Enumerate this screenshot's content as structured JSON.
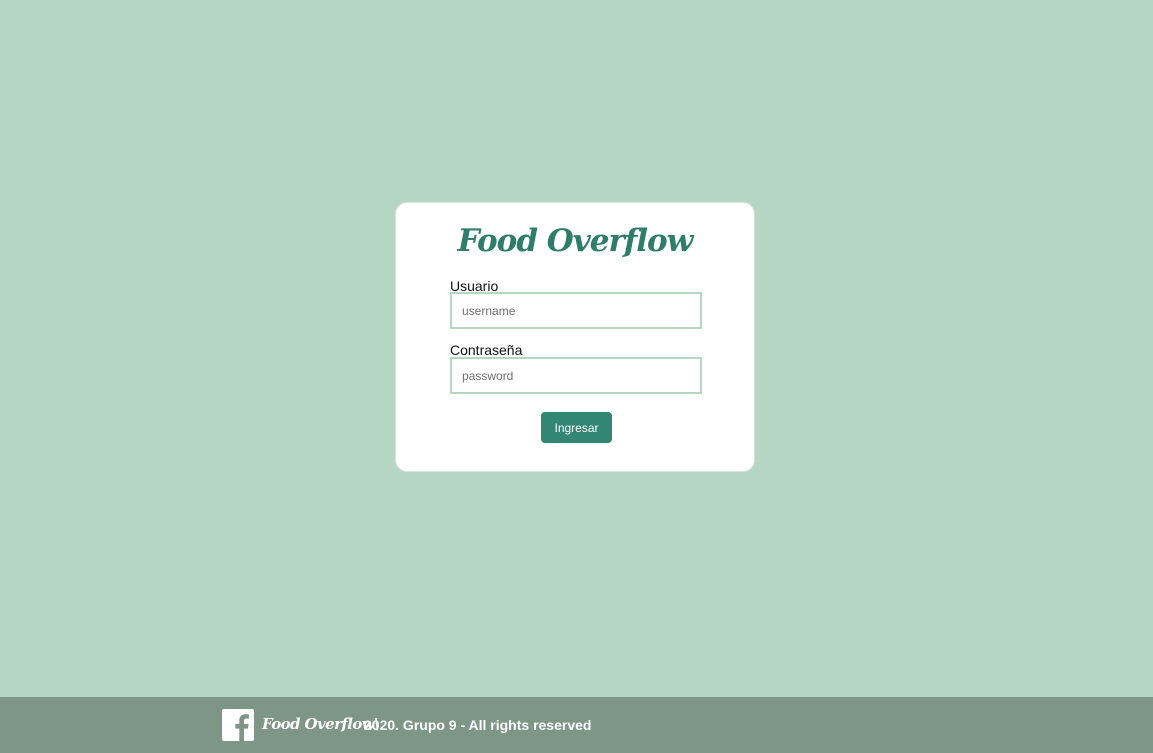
{
  "login_card": {
    "brand": "Food Overflow",
    "username": {
      "label": "Usuario",
      "value": "",
      "placeholder": "username"
    },
    "password": {
      "label": "Contraseña",
      "value": "",
      "placeholder": "password"
    },
    "submit_label": "Ingresar"
  },
  "footer": {
    "icon": "facebook-icon",
    "brand": "Food Overflow\\",
    "text": "2020. Grupo 9 - All rights reserved"
  },
  "colors": {
    "page_background": "#b4d6c2",
    "brand": "#2e7d6a",
    "button": "#338674",
    "footer_background": "#7e9686"
  }
}
